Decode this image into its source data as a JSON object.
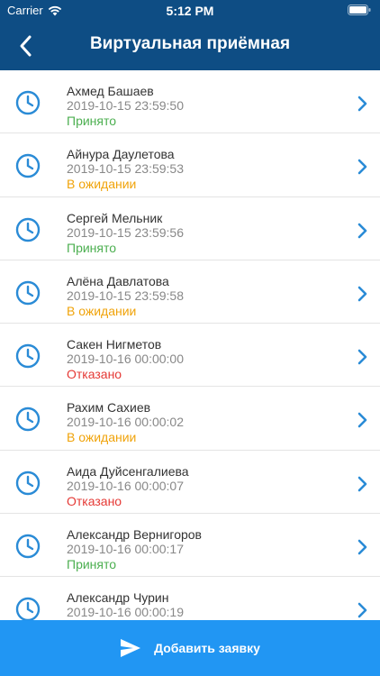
{
  "status_bar": {
    "carrier": "Carrier",
    "time": "5:12 PM"
  },
  "header": {
    "title": "Виртуальная приёмная"
  },
  "colors": {
    "header": "#0e4d84",
    "accent": "#2196f3",
    "accepted": "#4caf50",
    "pending": "#f0a30a",
    "rejected": "#e53935"
  },
  "requests": [
    {
      "name": "Ахмед Башаев",
      "date": "2019-10-15 23:59:50",
      "status": "Принято",
      "state": "accepted"
    },
    {
      "name": "Айнура Даулетова",
      "date": "2019-10-15 23:59:53",
      "status": "В ожидании",
      "state": "pending"
    },
    {
      "name": "Сергей Мельник",
      "date": "2019-10-15 23:59:56",
      "status": "Принято",
      "state": "accepted"
    },
    {
      "name": "Алёна Давлатова",
      "date": "2019-10-15 23:59:58",
      "status": "В ожидании",
      "state": "pending"
    },
    {
      "name": "Сакен Нигметов",
      "date": "2019-10-16 00:00:00",
      "status": "Отказано",
      "state": "rejected"
    },
    {
      "name": "Рахим Сахиев",
      "date": "2019-10-16 00:00:02",
      "status": "В ожидании",
      "state": "pending"
    },
    {
      "name": "Аида Дуйсенгалиева",
      "date": "2019-10-16 00:00:07",
      "status": "Отказано",
      "state": "rejected"
    },
    {
      "name": "Александр Вернигоров",
      "date": "2019-10-16 00:00:17",
      "status": "Принято",
      "state": "accepted"
    },
    {
      "name": "Александр Чурин",
      "date": "2019-10-16 00:00:19",
      "status": "",
      "state": ""
    }
  ],
  "add_button": {
    "label": "Добавить заявку"
  }
}
